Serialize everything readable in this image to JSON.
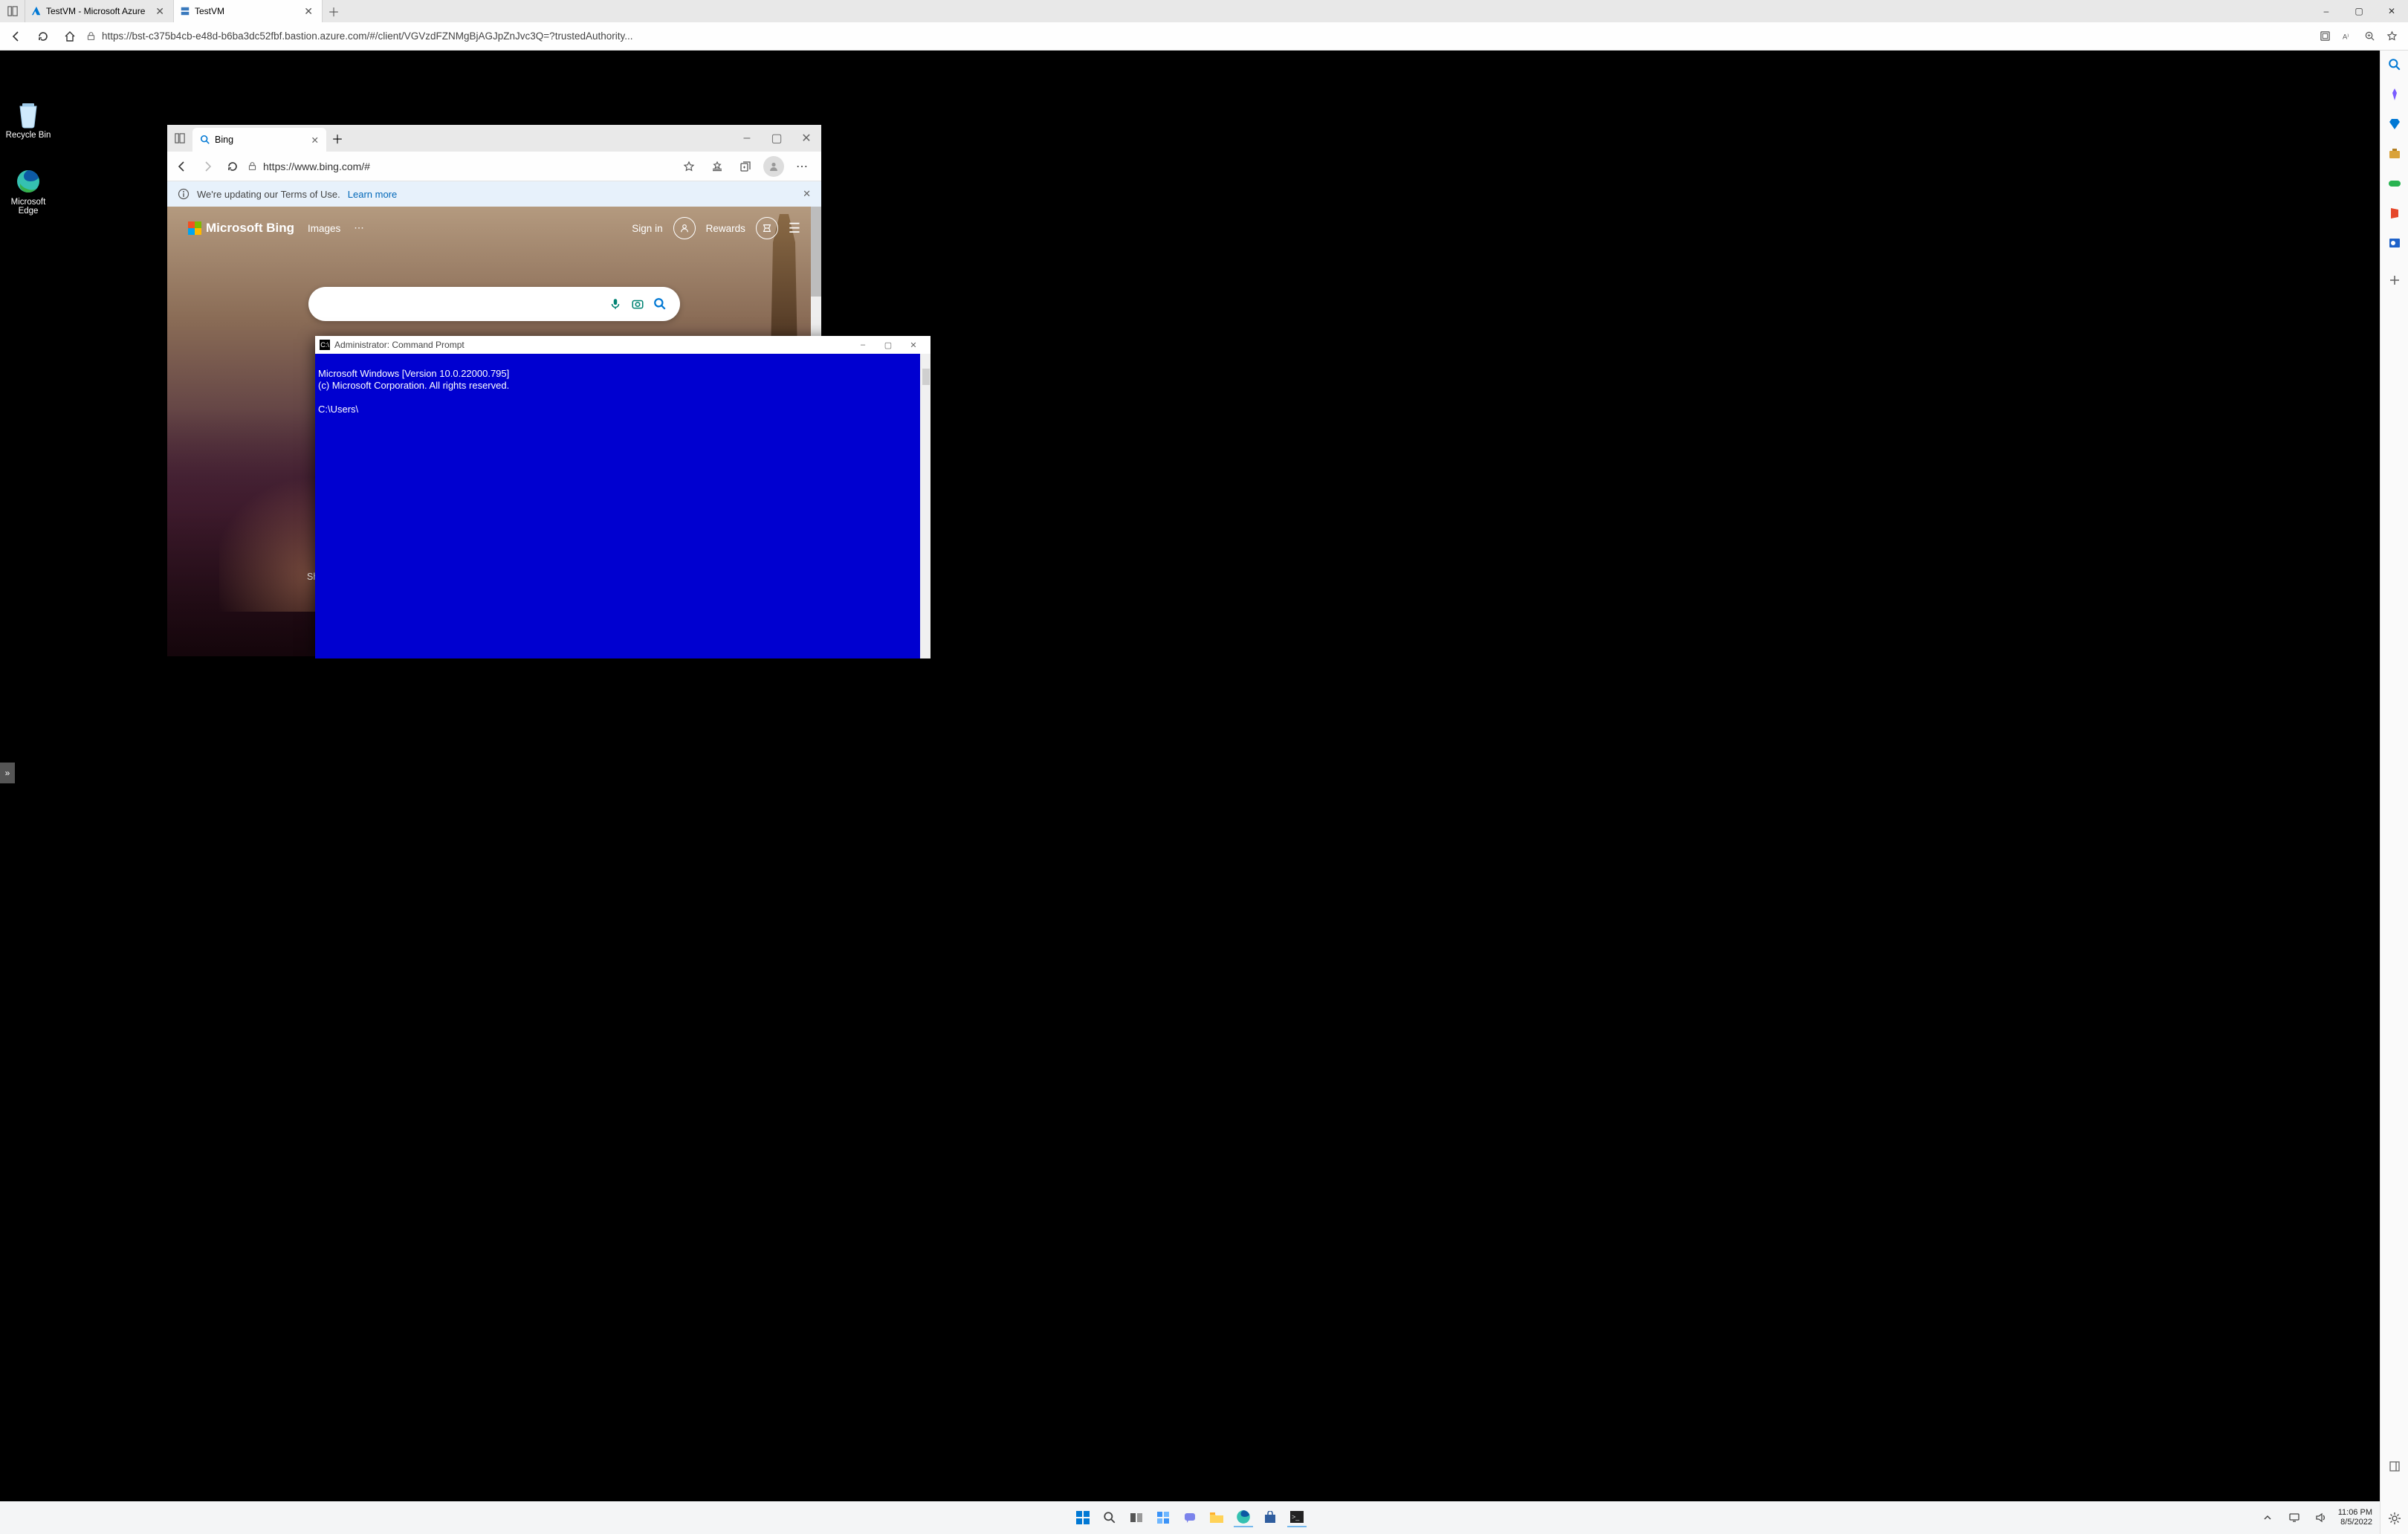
{
  "outer_browser": {
    "tabs": [
      {
        "title": "TestVM  - Microsoft Azure",
        "favicon": "azure"
      },
      {
        "title": "TestVM",
        "favicon": "server"
      }
    ],
    "active_tab_index": 1,
    "url": "https://bst-c375b4cb-e48d-b6ba3dc52fbf.bastion.azure.com/#/client/VGVzdFZNMgBjAGJpZnJvc3Q=?trustedAuthority...",
    "window_controls": {
      "minimize": "–",
      "maximize": "▢",
      "close": "✕"
    }
  },
  "outer_sidebar": {
    "items": [
      "search",
      "copilot",
      "shopping",
      "wallet",
      "games",
      "office",
      "outlook",
      "add"
    ]
  },
  "remote_desktop": {
    "icons": [
      {
        "name": "Recycle Bin",
        "glyph": "recycle"
      },
      {
        "name": "Microsoft Edge",
        "glyph": "edge"
      }
    ]
  },
  "inner_edge": {
    "tab_title": "Bing",
    "url": "https://www.bing.com/#",
    "notice_text": "We're updating our Terms of Use.",
    "notice_link": "Learn more",
    "bing": {
      "logo_text": "Microsoft Bing",
      "nav_images": "Images",
      "signin": "Sign in",
      "rewards": "Rewards",
      "search_placeholder": "",
      "show_label": "Sh"
    }
  },
  "cmd": {
    "title": "Administrator: Command Prompt",
    "lines": "Microsoft Windows [Version 10.0.22000.795]\n(c) Microsoft Corporation. All rights reserved.\n\nC:\\Users\\"
  },
  "vm_taskbar": {
    "time": "11:06 PM",
    "date": "8/5/2022"
  },
  "colors": {
    "cmd_bg": "#0000d0",
    "accent": "#0078d4",
    "bing_mic": "#008373"
  }
}
